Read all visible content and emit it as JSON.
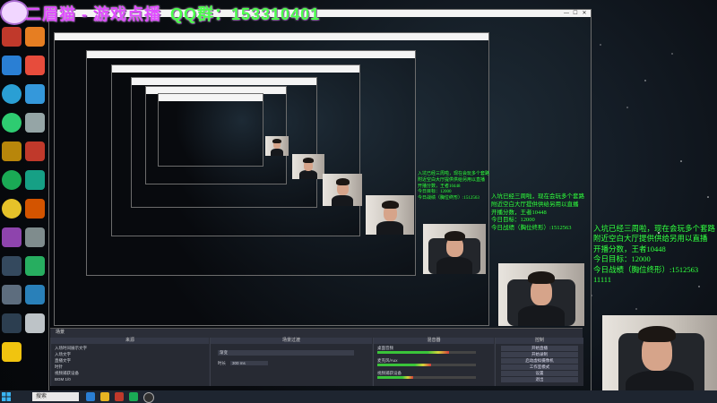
{
  "overlay": {
    "title": "二眉猫 - 游戏点播",
    "qq_label": "QQ群：153310401"
  },
  "stream_info": {
    "lines": [
      "入坑已经三周啦，现在会玩多个套路",
      "附近空白大厅提供供给另用以直播",
      "开播分数，王者10448",
      "今日目标：12000",
      "今日战绩（胸位终形）:1512563",
      "11111"
    ]
  },
  "window": {
    "min_glyph": "—",
    "max_glyph": "☐",
    "close_glyph": "✕"
  },
  "obs": {
    "scenes_header": "场景",
    "sources_header": "来源",
    "mixer_header": "混音器",
    "transitions_header": "场景过渡",
    "controls_header": "控制",
    "sources": [
      "入场时间展示文字",
      "入场文字",
      "直播文字",
      "时针",
      "视频捕获设备",
      "BGM 1/0"
    ],
    "mixer_tracks": [
      "桌面音频",
      "麦克风/Aux",
      "视频捕获设备"
    ],
    "transition_label": "渐变",
    "duration_label": "时长",
    "duration_value": "300 ms",
    "controls": [
      "开始直播",
      "开始录制",
      "启动虚拟摄像机",
      "工作室模式",
      "设置",
      "退出"
    ]
  },
  "taskbar": {
    "search_placeholder": "搜索"
  },
  "colors": {
    "overlay_title": "#e04cff",
    "qq_text": "#4cff4c",
    "stream_text": "#37ff4b",
    "taskbar": "#1e2530"
  },
  "icons": [
    "windows-start-icon",
    "search-icon",
    "obs-icon",
    "browser-icon",
    "folder-icon"
  ]
}
